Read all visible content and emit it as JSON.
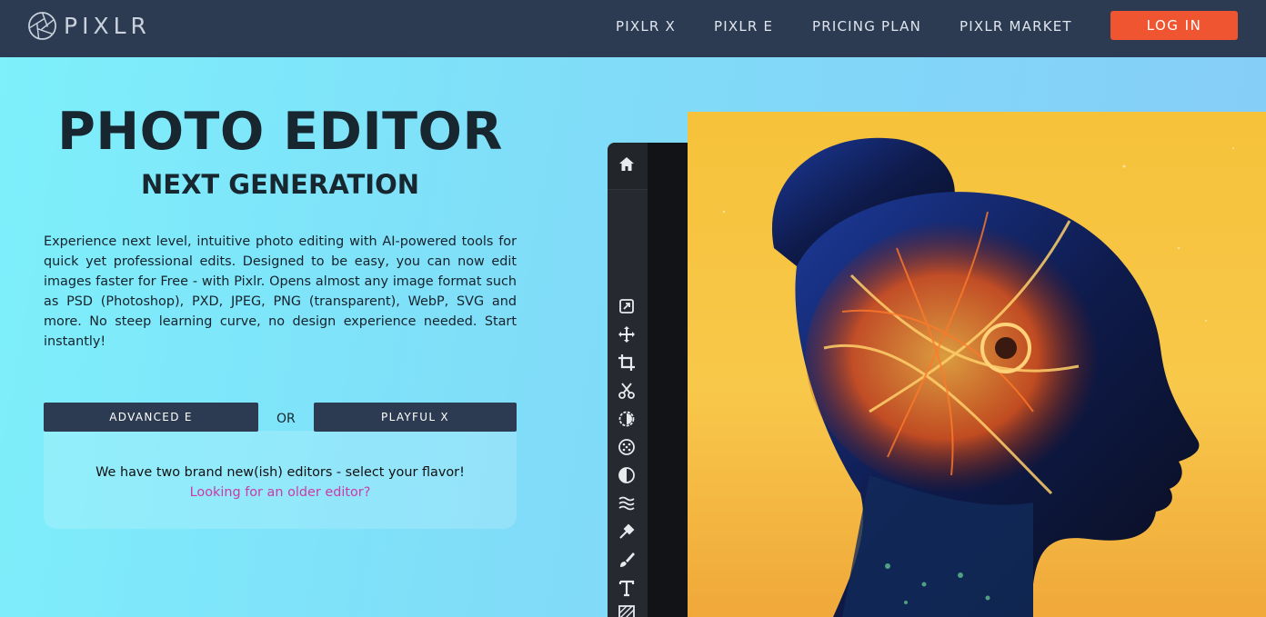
{
  "header": {
    "brand": "PIXLR",
    "nav": [
      {
        "label": "PIXLR X"
      },
      {
        "label": "PIXLR E"
      },
      {
        "label": "PRICING PLAN"
      },
      {
        "label": "PIXLR MARKET"
      }
    ],
    "login_label": "LOG IN",
    "login_color": "#ef5530",
    "bar_color": "#2c3b52"
  },
  "hero": {
    "title": "PHOTO EDITOR",
    "subtitle": "NEXT GENERATION",
    "description": "Experience next level, intuitive photo editing with AI-powered tools for quick yet professional edits. Designed to be easy, you can now edit images faster for Free - with Pixlr. Opens almost any image format such as PSD (Photoshop), PXD, JPEG, PNG (transparent), WebP, SVG and more. No steep learning curve, no design experience needed. Start instantly!"
  },
  "editors": {
    "advanced_label": "ADVANCED E",
    "or_label": "OR",
    "playful_label": "PLAYFUL X",
    "flavor_text": "We have two brand new(ish) editors - select your flavor!",
    "older_link": "Looking for an older editor?",
    "link_color": "#cc3aa8"
  },
  "editor_preview": {
    "tools": [
      "home-icon",
      "arrange-icon",
      "move-icon",
      "crop-icon",
      "cutout-icon",
      "adjust-icon",
      "filter-icon",
      "effect-icon",
      "liquify-icon",
      "heal-icon",
      "brush-icon",
      "text-icon",
      "pattern-icon"
    ]
  }
}
